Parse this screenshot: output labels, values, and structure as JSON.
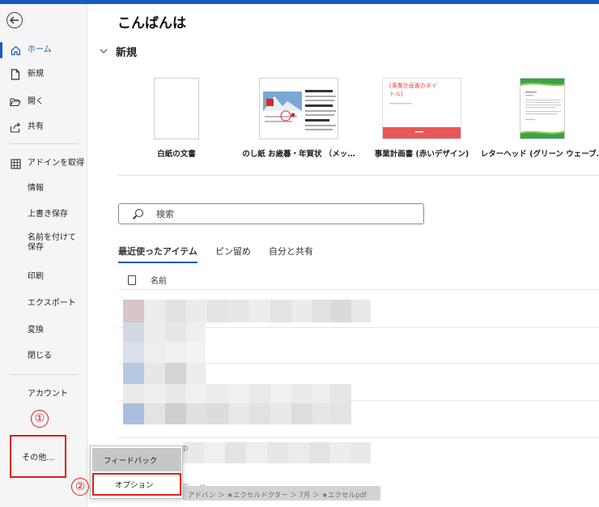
{
  "greeting": "こんばんは",
  "sidebar": {
    "back_icon": "arrow-left-circle-icon",
    "items": [
      {
        "label": "ホーム",
        "icon": "home-icon"
      },
      {
        "label": "新規",
        "icon": "new-doc-icon"
      },
      {
        "label": "開く",
        "icon": "folder-open-icon"
      },
      {
        "label": "共有",
        "icon": "share-icon"
      },
      {
        "label": "アドインを取得",
        "icon": "grid-icon"
      },
      {
        "label": "情報"
      },
      {
        "label": "上書き保存"
      },
      {
        "label": "名前を付けて保存"
      },
      {
        "label": "印刷"
      },
      {
        "label": "エクスポート"
      },
      {
        "label": "変換"
      },
      {
        "label": "閉じる"
      },
      {
        "label": "アカウント"
      },
      {
        "label": "その他..."
      }
    ]
  },
  "new_section": {
    "title": "新規"
  },
  "templates": [
    {
      "caption": "白紙の文書"
    },
    {
      "caption": "のし紙 お歳暮・年賀状 （メッ…"
    },
    {
      "caption": "事業計画書 (赤いデザイン)",
      "thumb_title": "[事業計画書のタイトル]"
    },
    {
      "caption": "レターヘッド (グリーン ウェーブ…"
    }
  ],
  "search": {
    "placeholder": "検索"
  },
  "tabs": [
    {
      "label": "最近使ったアイテム",
      "active": true
    },
    {
      "label": "ピン留め"
    },
    {
      "label": "自分と共有"
    }
  ],
  "list": {
    "header_name": "名前"
  },
  "flyout": {
    "feedback": "フィードバック",
    "options": "オプション"
  },
  "annotations": {
    "one": "①",
    "two": "②"
  },
  "background_file": {
    "ext": "p",
    "name_fragment": "画.pdf",
    "path": "アドバン ＞ ★エクセルドクター ＞ 7月 ＞ ★エクセルpdf"
  },
  "colors": {
    "accent": "#185abd",
    "annotation": "#e21c1c"
  }
}
